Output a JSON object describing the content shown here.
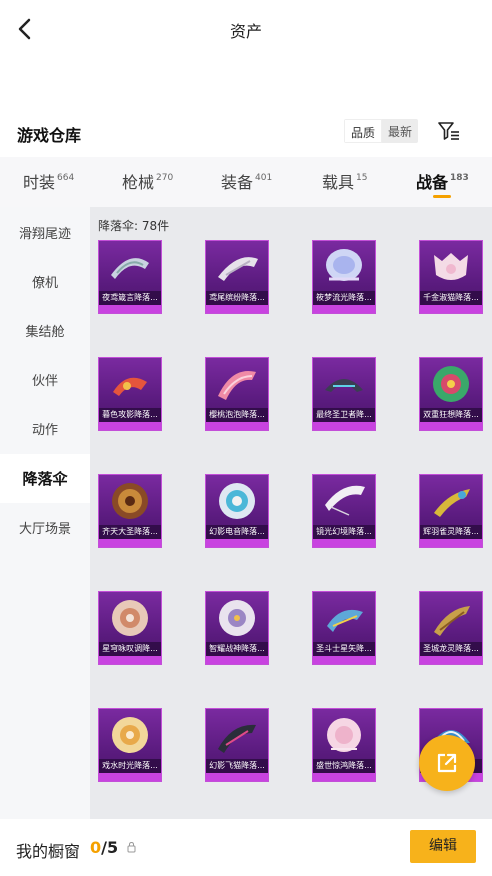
{
  "header": {
    "title": "资产"
  },
  "warehouse": {
    "title": "游戏仓库",
    "sort_quality": "品质",
    "sort_latest": "最新"
  },
  "tabs": [
    {
      "label": "时装",
      "count": "664"
    },
    {
      "label": "枪械",
      "count": "270"
    },
    {
      "label": "装备",
      "count": "401"
    },
    {
      "label": "载具",
      "count": "15"
    },
    {
      "label": "战备",
      "count": "183"
    }
  ],
  "sidebar": {
    "items": [
      "滑翔尾迹",
      "僚机",
      "集结舱",
      "伙伴",
      "动作",
      "降落伞",
      "大厅场景"
    ],
    "active": "降落伞"
  },
  "content": {
    "count_label": "降落伞: 78件",
    "items": [
      {
        "name": "夜鸢箴言降落..."
      },
      {
        "name": "鸢尾缤纷降落..."
      },
      {
        "name": "筱梦流光降落..."
      },
      {
        "name": "千金淑猫降落..."
      },
      {
        "name": "暮色攻影降落..."
      },
      {
        "name": "樱桃泡泡降落..."
      },
      {
        "name": "最终圣卫者降..."
      },
      {
        "name": "双重狂想降落..."
      },
      {
        "name": "齐天大圣降落..."
      },
      {
        "name": "幻影电音降落..."
      },
      {
        "name": "镜光幻境降落..."
      },
      {
        "name": "辉羽雀灵降落..."
      },
      {
        "name": "星穹咏叹调降..."
      },
      {
        "name": "智耀战神降落..."
      },
      {
        "name": "圣斗士星矢降..."
      },
      {
        "name": "圣城龙灵降落..."
      },
      {
        "name": "戏水时光降落..."
      },
      {
        "name": "幻影飞猫降落..."
      },
      {
        "name": "盛世惊鸿降落..."
      },
      {
        "name": ""
      }
    ]
  },
  "bottom": {
    "showcase_label": "我的橱窗",
    "showcase_current": "0",
    "showcase_total": "/5",
    "edit_label": "编辑"
  },
  "colors": {
    "accent": "#f7b21b",
    "card_purple": "#5a1b7e",
    "card_border": "#c34fd8"
  },
  "icons": {
    "back": "chevron-left-icon",
    "filter": "filter-icon",
    "share": "external-link-icon",
    "lock": "lock-icon"
  }
}
